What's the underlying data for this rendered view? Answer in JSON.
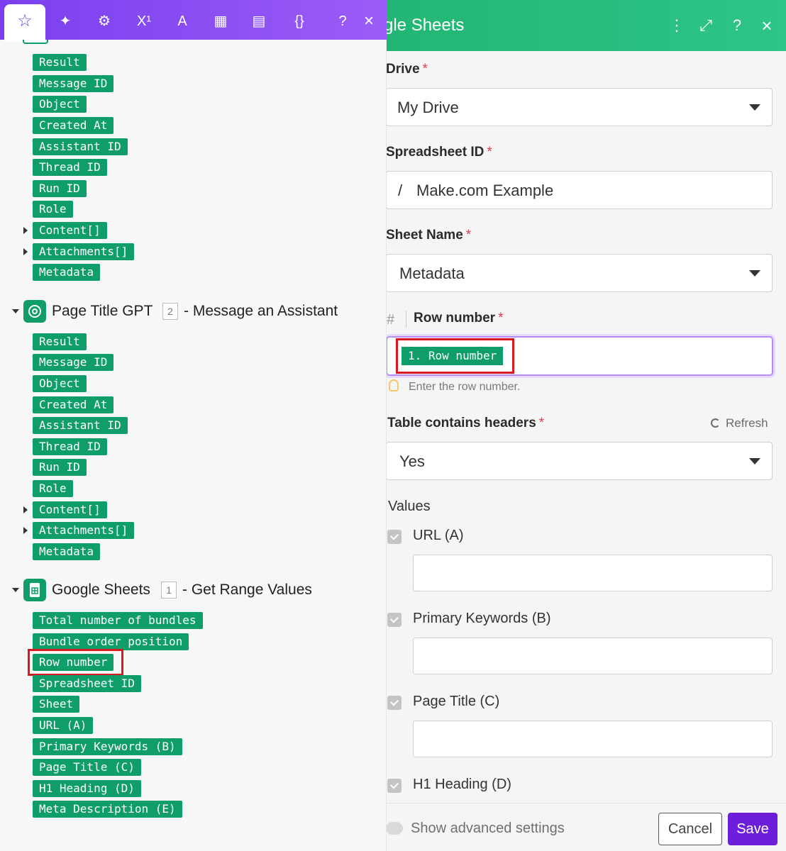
{
  "toolbar": {
    "star_glyph": "☆",
    "sparkle_glyph": "✦",
    "gear_glyph": "⚙",
    "superscript_glyph": "X¹",
    "text_glyph": "A",
    "calendar_glyph": "▦",
    "table_glyph": "▤",
    "braces_glyph": "{}",
    "help_glyph": "?",
    "close_glyph": "×"
  },
  "section0": {
    "items": [
      "Result",
      "Message ID",
      "Object",
      "Created At",
      "Assistant ID",
      "Thread ID",
      "Run ID",
      "Role",
      "Content[]",
      "Attachments[]",
      "Metadata"
    ]
  },
  "section1": {
    "title": "Page Title GPT",
    "badge": "2",
    "subtitle": "- Message an Assistant",
    "items": [
      "Result",
      "Message ID",
      "Object",
      "Created At",
      "Assistant ID",
      "Thread ID",
      "Run ID",
      "Role",
      "Content[]",
      "Attachments[]",
      "Metadata"
    ]
  },
  "section2": {
    "title": "Google Sheets",
    "badge": "1",
    "subtitle": "- Get Range Values",
    "items": [
      "Total number of bundles",
      "Bundle order position",
      "Row number",
      "Spreadsheet ID",
      "Sheet",
      "URL (A)",
      "Primary Keywords (B)",
      "Page Title (C)",
      "H1 Heading (D)",
      "Meta Description (E)"
    ]
  },
  "right": {
    "header": {
      "title": "gle Sheets",
      "menu_glyph": "⋮",
      "expand_glyph": "⤢",
      "help_glyph": "?",
      "close_glyph": "×"
    },
    "drive": {
      "label": "Drive",
      "value": "My Drive"
    },
    "spreadsheet": {
      "label": "Spreadsheet ID",
      "slash": "/",
      "value": "Make.com Example"
    },
    "sheet": {
      "label": "Sheet Name",
      "value": "Metadata"
    },
    "row": {
      "hash": "#",
      "label": "Row number",
      "chip": "1. Row number",
      "hint": "Enter the row number."
    },
    "headers": {
      "label": "Table contains headers",
      "refresh": "Refresh",
      "value": "Yes"
    },
    "values": {
      "label": "Values",
      "items": [
        "URL (A)",
        "Primary Keywords (B)",
        "Page Title (C)",
        "H1 Heading (D)"
      ]
    },
    "required_mark": "*",
    "footer": {
      "advanced": "Show advanced settings",
      "cancel": "Cancel",
      "save": "Save"
    }
  },
  "colors": {
    "pill_green": "#0f9d6a",
    "toolbar_purple": "#8a4df3",
    "header_green": "#2ec58a",
    "highlight_red": "#d71920",
    "save_purple": "#6d1ed8"
  }
}
